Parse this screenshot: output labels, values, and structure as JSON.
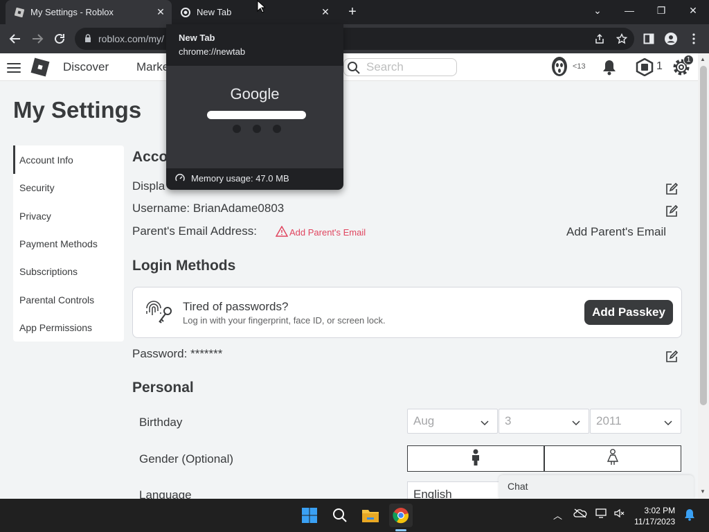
{
  "browser": {
    "tabs": [
      {
        "title": "My Settings - Roblox"
      },
      {
        "title": "New Tab"
      }
    ],
    "address": "roblox.com/my/",
    "hover_card": {
      "title": "New Tab",
      "url": "chrome://newtab",
      "preview_brand": "Google",
      "memory": "Memory usage: 47.0 MB"
    }
  },
  "header": {
    "nav": [
      "Discover",
      "Marke"
    ],
    "search_placeholder": "Search",
    "friends_count": "<13",
    "robux": "1",
    "settings_badge": "1"
  },
  "page": {
    "title": "My Settings",
    "sidebar": [
      "Account Info",
      "Security",
      "Privacy",
      "Payment Methods",
      "Subscriptions",
      "Parental Controls",
      "App Permissions"
    ],
    "account_section": "Acco",
    "display_label": "Displa",
    "username_label": "Username: BrianAdame0803",
    "parent_email_label": "Parent's Email Address:",
    "parent_email_warning": "Add Parent's Email",
    "parent_email_action": "Add Parent's Email",
    "login_section": "Login Methods",
    "passkey": {
      "title": "Tired of passwords?",
      "subtitle": "Log in with your fingerprint, face ID, or screen lock.",
      "button": "Add Passkey"
    },
    "password_label": "Password: *******",
    "personal_section": "Personal",
    "birthday_label": "Birthday",
    "birthday": {
      "month": "Aug",
      "day": "3",
      "year": "2011"
    },
    "gender_label": "Gender (Optional)",
    "language_label": "Language",
    "language_value": "English",
    "chat": "Chat"
  },
  "taskbar": {
    "time": "3:02 PM",
    "date": "11/17/2023"
  },
  "colors": {
    "accent_dark": "#393b3d",
    "warning": "#e0455f",
    "chrome_bg": "#202124"
  }
}
